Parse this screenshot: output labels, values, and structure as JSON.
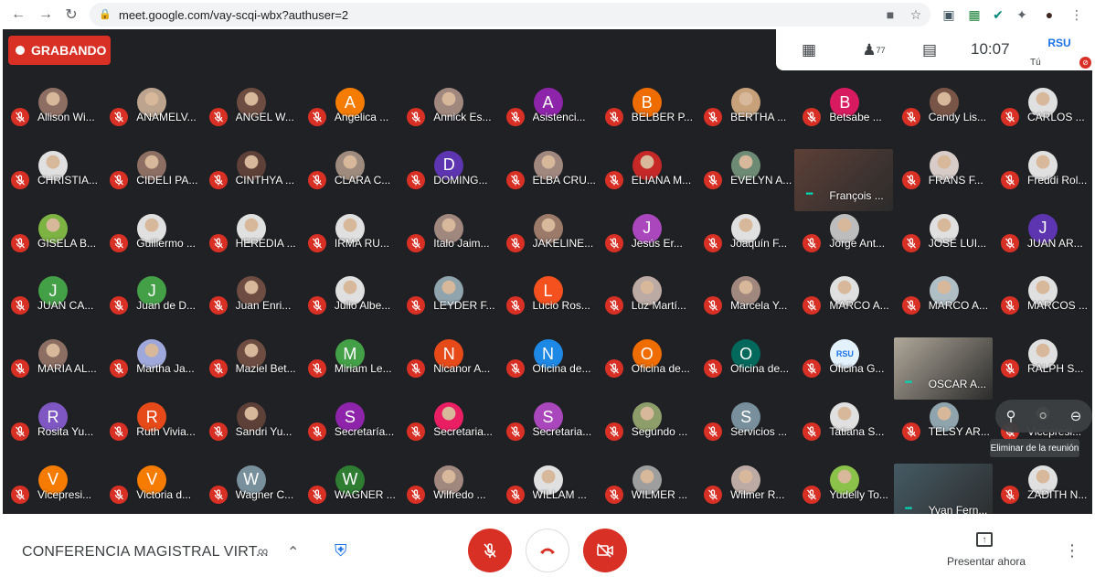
{
  "browser": {
    "url": "meet.google.com/vay-scqi-wbx?authuser=2",
    "back_icon": "arrow-left-icon",
    "forward_icon": "arrow-right-icon",
    "reload_icon": "reload-icon"
  },
  "meeting": {
    "recording_label": "GRABANDO",
    "participant_count": "77",
    "clock": "10:07",
    "self_label": "Tú",
    "self_thumb_text": "RSU",
    "title": "CONFERENCIA MAGISTRAL VIRT...",
    "present_label": "Presentar ahora",
    "tooltip": "Eliminar de la reunión",
    "mute_color": "#d93025",
    "speaking_color": "#00d4b4"
  },
  "participants": [
    {
      "name": "Allison Wi...",
      "initial": "",
      "color": "#8d6e63"
    },
    {
      "name": "ANAMELV...",
      "initial": "",
      "color": "#bca48f"
    },
    {
      "name": "ANGEL W...",
      "initial": "",
      "color": "#6d4c41"
    },
    {
      "name": "Angelica ...",
      "initial": "A",
      "color": "#f57c00"
    },
    {
      "name": "Annick Es...",
      "initial": "",
      "color": "#a1887f"
    },
    {
      "name": "Asistenci...",
      "initial": "A",
      "color": "#8e24aa"
    },
    {
      "name": "BELBER P...",
      "initial": "B",
      "color": "#ef6c00"
    },
    {
      "name": "BERTHA ...",
      "initial": "",
      "color": "#c7a17a"
    },
    {
      "name": "Betsabe ...",
      "initial": "B",
      "color": "#d81b60"
    },
    {
      "name": "Candy Lis...",
      "initial": "",
      "color": "#795548"
    },
    {
      "name": "CARLOS ...",
      "initial": "",
      "color": "#e0e0e0"
    },
    {
      "name": "CHRISTIA...",
      "initial": "",
      "color": "#e0e0e0"
    },
    {
      "name": "CIDELI PA...",
      "initial": "",
      "color": "#8d6e63"
    },
    {
      "name": "CINTHYA ...",
      "initial": "",
      "color": "#5d4037"
    },
    {
      "name": "CLARA C...",
      "initial": "",
      "color": "#9e8b7e"
    },
    {
      "name": "DOMING...",
      "initial": "D",
      "color": "#5e35b1"
    },
    {
      "name": "ELBA CRU...",
      "initial": "",
      "color": "#a1887f"
    },
    {
      "name": "ELIANA M...",
      "initial": "",
      "color": "#c62828"
    },
    {
      "name": "EVELYN A...",
      "initial": "",
      "color": "#6d8b74"
    },
    {
      "name": "François ...",
      "initial": "",
      "color": "#5d4037",
      "video": true,
      "speaking": true
    },
    {
      "name": "FRANS F...",
      "initial": "",
      "color": "#d7ccc8"
    },
    {
      "name": "Freddi Rol...",
      "initial": "",
      "color": "#e0e0e0"
    },
    {
      "name": "GISELA B...",
      "initial": "",
      "color": "#7cb342"
    },
    {
      "name": "Guillermo ...",
      "initial": "",
      "color": "#e0e0e0"
    },
    {
      "name": "HEREDIA ...",
      "initial": "",
      "color": "#e0e0e0"
    },
    {
      "name": "IRMA RU...",
      "initial": "",
      "color": "#e0e0e0"
    },
    {
      "name": "Italo Jaim...",
      "initial": "",
      "color": "#a1887f"
    },
    {
      "name": "JAKELINE...",
      "initial": "",
      "color": "#9c7a6a"
    },
    {
      "name": "Jesús Er...",
      "initial": "J",
      "color": "#ab47bc"
    },
    {
      "name": "Joaquín F...",
      "initial": "",
      "color": "#e0e0e0"
    },
    {
      "name": "Jorge Ant...",
      "initial": "",
      "color": "#bdbdbd"
    },
    {
      "name": "JOSE LUI...",
      "initial": "",
      "color": "#e0e0e0"
    },
    {
      "name": "JUAN AR...",
      "initial": "J",
      "color": "#5e35b1"
    },
    {
      "name": "JUAN CA...",
      "initial": "J",
      "color": "#43a047"
    },
    {
      "name": "Juan de D...",
      "initial": "J",
      "color": "#43a047"
    },
    {
      "name": "Juan Enri...",
      "initial": "",
      "color": "#6d4c41"
    },
    {
      "name": "Julio Albe...",
      "initial": "",
      "color": "#e0e0e0"
    },
    {
      "name": "LEYDER F...",
      "initial": "",
      "color": "#90a4ae"
    },
    {
      "name": "Lucio Ros...",
      "initial": "L",
      "color": "#f4511e"
    },
    {
      "name": "Luz Martí...",
      "initial": "",
      "color": "#bcaaa4"
    },
    {
      "name": "Marcela Y...",
      "initial": "",
      "color": "#a1887f"
    },
    {
      "name": "MARCO A...",
      "initial": "",
      "color": "#e0e0e0"
    },
    {
      "name": "MARCO A...",
      "initial": "",
      "color": "#b0bec5"
    },
    {
      "name": "MARCOS ...",
      "initial": "",
      "color": "#e0e0e0"
    },
    {
      "name": "MARIA AL...",
      "initial": "",
      "color": "#8d6e63"
    },
    {
      "name": "Martha Ja...",
      "initial": "",
      "color": "#9fa8da"
    },
    {
      "name": "Maziel Bet...",
      "initial": "",
      "color": "#6d4c41"
    },
    {
      "name": "Miriam Le...",
      "initial": "M",
      "color": "#43a047"
    },
    {
      "name": "Nicanor A...",
      "initial": "N",
      "color": "#e64a19"
    },
    {
      "name": "Oficina de...",
      "initial": "N",
      "color": "#1e88e5"
    },
    {
      "name": "Oficina de...",
      "initial": "O",
      "color": "#ef6c00"
    },
    {
      "name": "Oficina de...",
      "initial": "O",
      "color": "#00695c"
    },
    {
      "name": "Oficina G...",
      "initial": "RSU",
      "color": "#e3f2fd"
    },
    {
      "name": "OSCAR A...",
      "initial": "",
      "color": "#b0a89a",
      "video": true,
      "speaking": true
    },
    {
      "name": "RALPH S...",
      "initial": "",
      "color": "#e0e0e0"
    },
    {
      "name": "Rosita Yu...",
      "initial": "R",
      "color": "#7e57c2"
    },
    {
      "name": "Ruth Vivia...",
      "initial": "R",
      "color": "#e64a19"
    },
    {
      "name": "Sandri Yu...",
      "initial": "",
      "color": "#5d4037"
    },
    {
      "name": "Secretaría...",
      "initial": "S",
      "color": "#8e24aa"
    },
    {
      "name": "Secretaria...",
      "initial": "",
      "color": "#e91e63"
    },
    {
      "name": "Secretaria...",
      "initial": "S",
      "color": "#ab47bc"
    },
    {
      "name": "Segundo ...",
      "initial": "",
      "color": "#8d9e6b"
    },
    {
      "name": "Servicios ...",
      "initial": "S",
      "color": "#78909c"
    },
    {
      "name": "Tatiana S...",
      "initial": "",
      "color": "#e0e0e0"
    },
    {
      "name": "TELSY AR...",
      "initial": "",
      "color": "#90a4ae"
    },
    {
      "name": "Vicepresi...",
      "initial": "",
      "color": "#202124"
    },
    {
      "name": "Vicepresi...",
      "initial": "V",
      "color": "#f57c00"
    },
    {
      "name": "Victoria d...",
      "initial": "V",
      "color": "#f57c00"
    },
    {
      "name": "Wagner C...",
      "initial": "W",
      "color": "#78909c"
    },
    {
      "name": "WAGNER ...",
      "initial": "W",
      "color": "#2e7d32"
    },
    {
      "name": "Wilfredo ...",
      "initial": "",
      "color": "#a1887f"
    },
    {
      "name": "WILLAM ...",
      "initial": "",
      "color": "#e0e0e0"
    },
    {
      "name": "WILMER ...",
      "initial": "",
      "color": "#9e9e9e"
    },
    {
      "name": "Wilmer R...",
      "initial": "",
      "color": "#bcaaa4"
    },
    {
      "name": "Yudelly To...",
      "initial": "",
      "color": "#8bc34a"
    },
    {
      "name": "Yvan Fern...",
      "initial": "",
      "color": "#455a64",
      "video": true,
      "speaking": true
    },
    {
      "name": "ZADITH N...",
      "initial": "",
      "color": "#e0e0e0"
    }
  ]
}
